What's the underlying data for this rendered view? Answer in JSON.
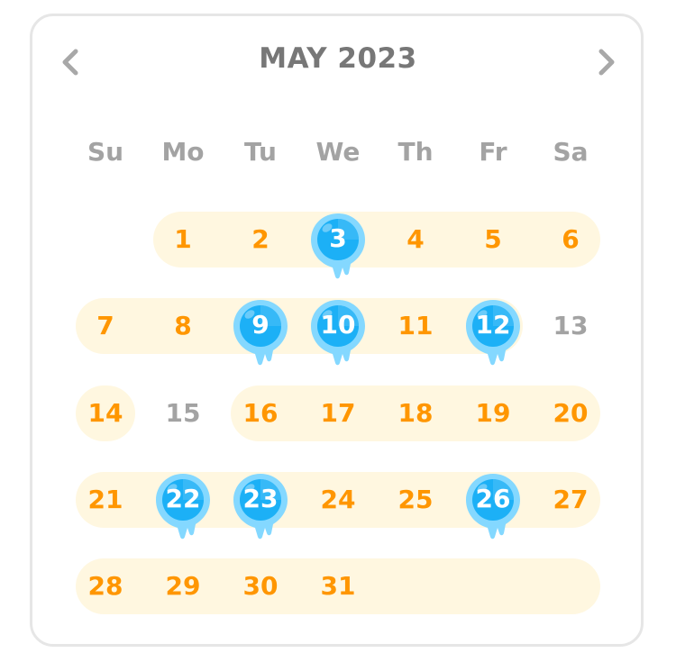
{
  "calendar": {
    "month_label": "MAY 2023",
    "prev_icon": "chevron-left-icon",
    "next_icon": "chevron-right-icon",
    "weekdays": [
      "Su",
      "Mo",
      "Tu",
      "We",
      "Th",
      "Fr",
      "Sa"
    ],
    "weeks": [
      [
        null,
        "1",
        "2",
        "3",
        "4",
        "5",
        "6"
      ],
      [
        "7",
        "8",
        "9",
        "10",
        "11",
        "12",
        "13"
      ],
      [
        "14",
        "15",
        "16",
        "17",
        "18",
        "19",
        "20"
      ],
      [
        "21",
        "22",
        "23",
        "24",
        "25",
        "26",
        "27"
      ],
      [
        "28",
        "29",
        "30",
        "31",
        null,
        null,
        null
      ]
    ],
    "streak_days": [
      "1",
      "2",
      "3",
      "4",
      "5",
      "6",
      "7",
      "8",
      "9",
      "10",
      "11",
      "12",
      "14",
      "16",
      "17",
      "18",
      "19",
      "20",
      "21",
      "22",
      "23",
      "24",
      "25",
      "26",
      "27",
      "28",
      "29",
      "30",
      "31"
    ],
    "inactive_days": [
      "13",
      "15"
    ],
    "practiced_badge_days": [
      "3",
      "9",
      "10",
      "12",
      "22",
      "23",
      "26"
    ],
    "badge_icon": "water-drop-badge-icon",
    "colors": {
      "streak_fill": "#fff7e0",
      "streak_text": "#ff9600",
      "inactive_text": "#a3a3a3",
      "badge_blue": "#1cb0f6",
      "badge_light": "#84d8ff",
      "title_text": "#777777"
    }
  }
}
